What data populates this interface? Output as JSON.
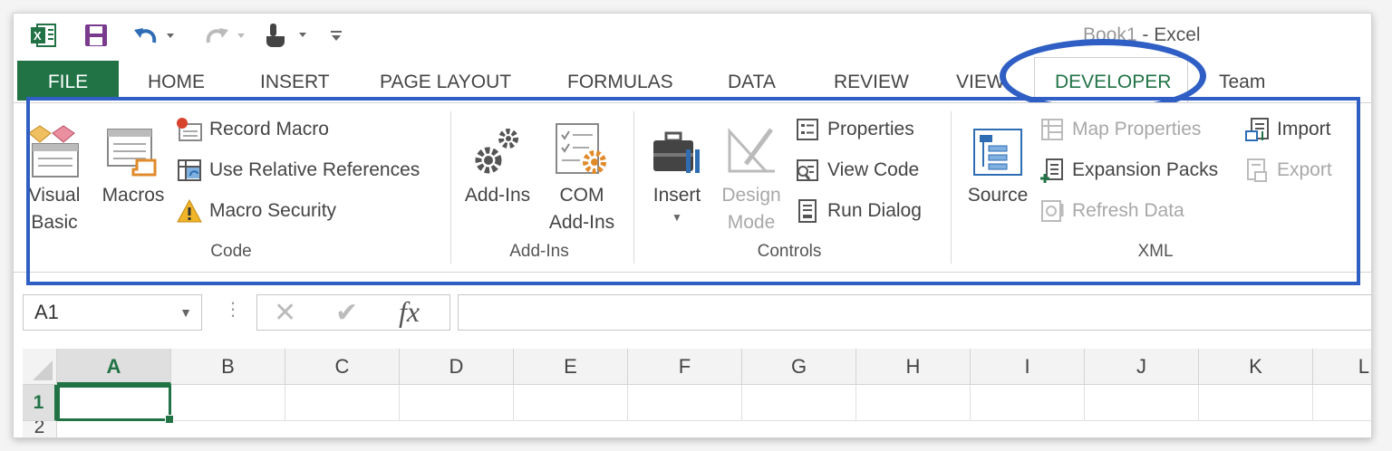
{
  "window": {
    "title_doc": "Book1",
    "title_sep": " - ",
    "title_app": "Excel"
  },
  "tabs": [
    {
      "label": "FILE"
    },
    {
      "label": "HOME"
    },
    {
      "label": "INSERT"
    },
    {
      "label": "PAGE LAYOUT"
    },
    {
      "label": "FORMULAS"
    },
    {
      "label": "DATA"
    },
    {
      "label": "REVIEW"
    },
    {
      "label": "VIEW"
    },
    {
      "label": "DEVELOPER"
    },
    {
      "label": "Team"
    }
  ],
  "ribbon": {
    "code": {
      "group_label": "Code",
      "visual_basic": "Visual Basic",
      "visual_basic_line1": "Visual",
      "visual_basic_line2": "Basic",
      "macros": "Macros",
      "record_macro": "Record Macro",
      "relative_refs": "Use Relative References",
      "macro_security": "Macro Security"
    },
    "addins": {
      "group_label": "Add-Ins",
      "addins": "Add-Ins",
      "com_line1": "COM",
      "com_line2": "Add-Ins"
    },
    "controls": {
      "group_label": "Controls",
      "insert": "Insert",
      "design_line1": "Design",
      "design_line2": "Mode",
      "properties": "Properties",
      "view_code": "View Code",
      "run_dialog": "Run Dialog"
    },
    "xml": {
      "group_label": "XML",
      "source": "Source",
      "map_properties": "Map Properties",
      "expansion_packs": "Expansion Packs",
      "refresh_data": "Refresh Data",
      "import": "Import",
      "export": "Export"
    }
  },
  "formula_bar": {
    "name_box": "A1",
    "formula": ""
  },
  "sheet": {
    "columns": [
      "A",
      "B",
      "C",
      "D",
      "E",
      "F",
      "G",
      "H",
      "I",
      "J",
      "K",
      "L"
    ],
    "rows": [
      "1",
      "2"
    ],
    "selected_cell": "A1"
  },
  "colors": {
    "excel_green": "#217346",
    "annotation_blue": "#2f5fc4"
  }
}
